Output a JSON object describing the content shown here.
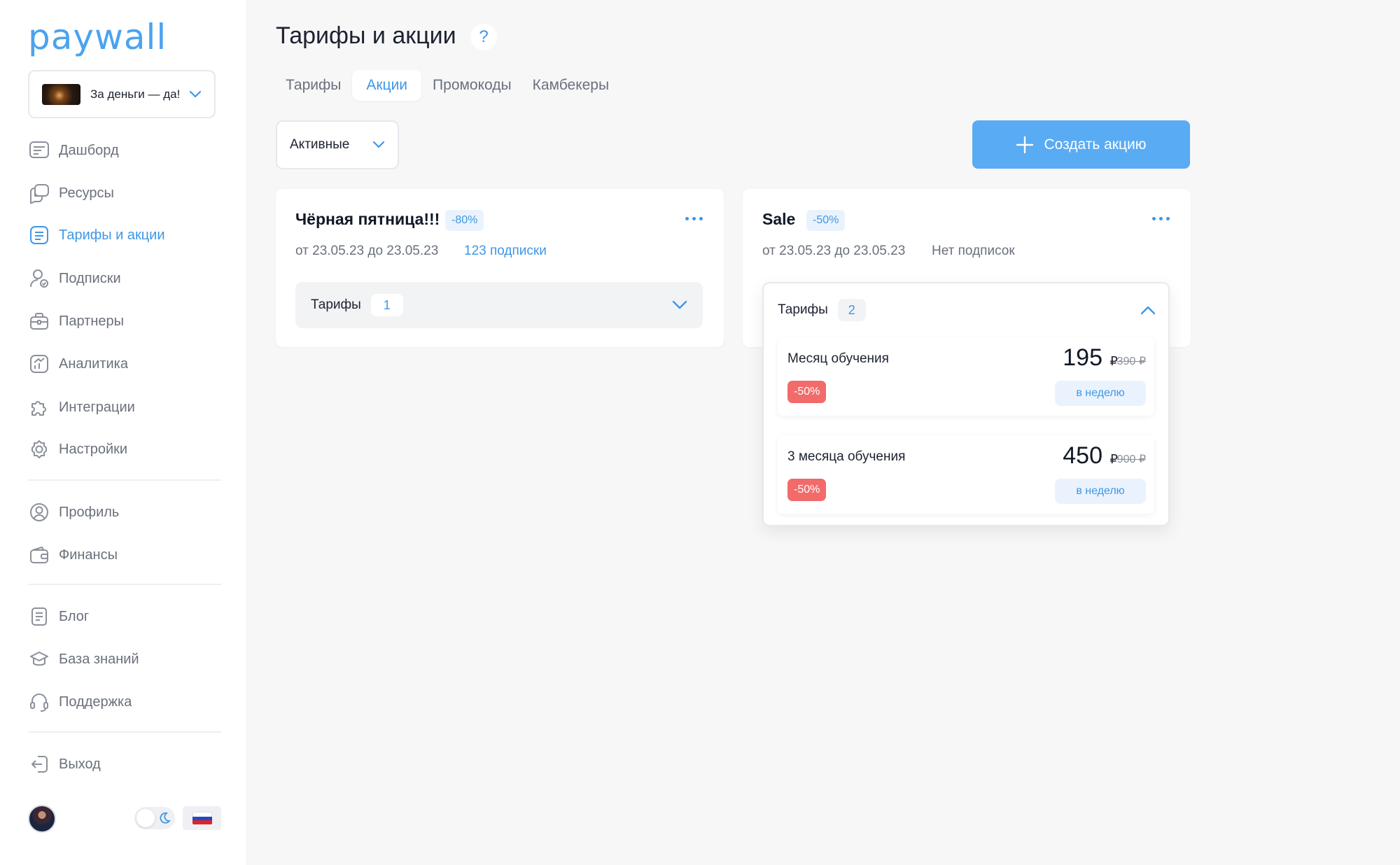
{
  "app": {
    "logo": "paywall",
    "project_name": "За деньги — да!"
  },
  "sidebar": {
    "items": [
      {
        "label": "Дашборд",
        "icon": "dashboard-icon"
      },
      {
        "label": "Ресурсы",
        "icon": "resources-icon"
      },
      {
        "label": "Тарифы и акции",
        "icon": "tariffs-icon",
        "active": true
      },
      {
        "label": "Подписки",
        "icon": "subscriptions-icon"
      },
      {
        "label": "Партнеры",
        "icon": "partners-icon"
      },
      {
        "label": "Аналитика",
        "icon": "analytics-icon"
      },
      {
        "label": "Интеграции",
        "icon": "integrations-icon"
      },
      {
        "label": "Настройки",
        "icon": "settings-icon"
      },
      {
        "label": "Профиль",
        "icon": "profile-icon"
      },
      {
        "label": "Финансы",
        "icon": "finance-icon"
      },
      {
        "label": "Блог",
        "icon": "blog-icon"
      },
      {
        "label": "База знаний",
        "icon": "knowledge-base-icon"
      },
      {
        "label": "Поддержка",
        "icon": "support-icon"
      },
      {
        "label": "Выход",
        "icon": "logout-icon"
      }
    ]
  },
  "header": {
    "title": "Тарифы и акции",
    "help": "?"
  },
  "tabs": [
    {
      "label": "Тарифы"
    },
    {
      "label": "Акции",
      "active": true
    },
    {
      "label": "Промокоды"
    },
    {
      "label": "Камбекеры"
    }
  ],
  "filter": {
    "value": "Активные"
  },
  "create_button": {
    "label": "Создать акцию"
  },
  "promos": [
    {
      "title": "Чёрная пятница!!!",
      "discount": "-80%",
      "dates": "от 23.05.23 до 23.05.23",
      "subscriptions": "123 подписки",
      "tariffs_label": "Тарифы",
      "tariffs_count": "1"
    },
    {
      "title": "Sale",
      "discount": "-50%",
      "dates": "от 23.05.23 до 23.05.23",
      "subscriptions": "Нет подписок",
      "tariffs_label": "Тарифы",
      "tariffs_count": "2",
      "expanded": true,
      "tariffs": [
        {
          "name": "Месяц обучения",
          "discount": "-50%",
          "price": "195",
          "currency": "₽",
          "old_price": "390 ₽",
          "period": "в неделю"
        },
        {
          "name": "3 месяца обучения",
          "discount": "-50%",
          "price": "450",
          "currency": "₽",
          "old_price": "900 ₽",
          "period": "в неделю"
        }
      ]
    }
  ],
  "colors": {
    "accent": "#3e97e8",
    "button": "#59abf3",
    "discount_red": "#f26b6b",
    "background": "#f7f7f8"
  }
}
